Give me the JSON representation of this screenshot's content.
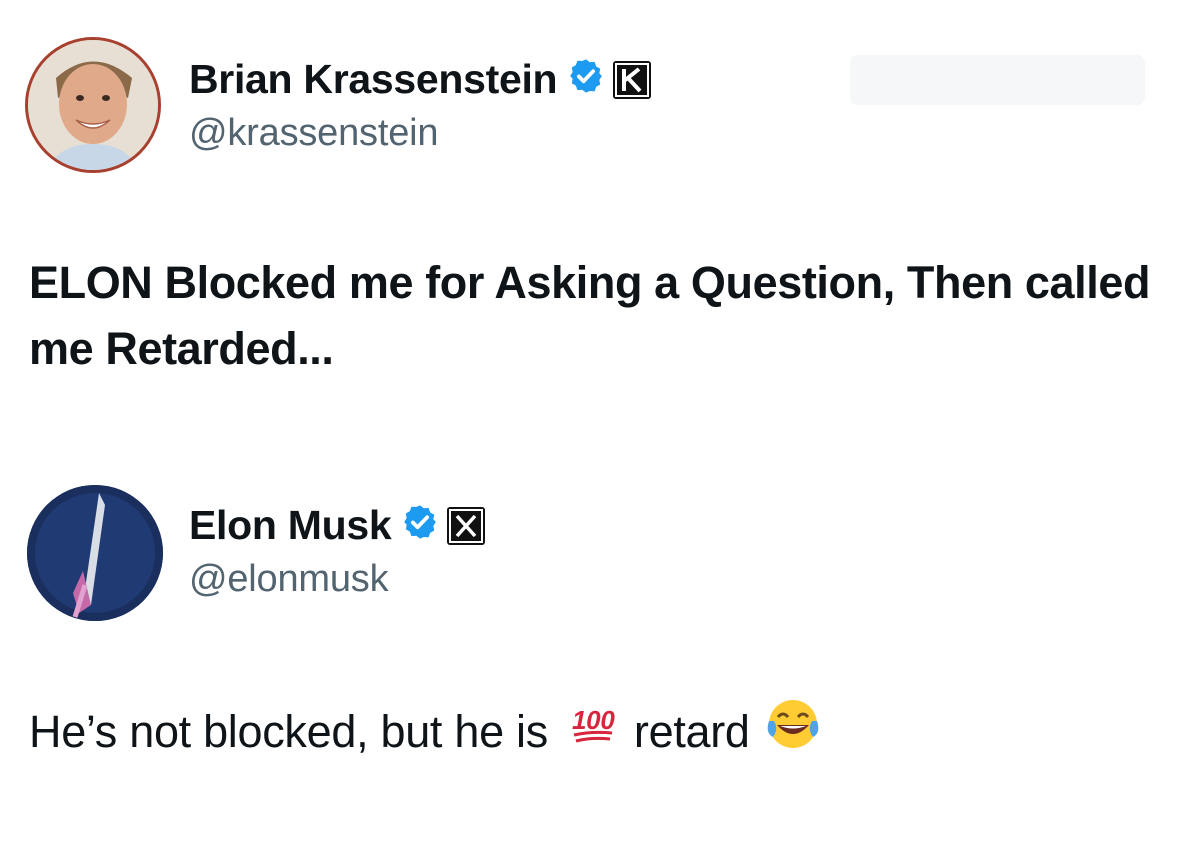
{
  "tweets": [
    {
      "name": "Brian Krassenstein",
      "handle": "@krassenstein",
      "text": "ELON Blocked me for Asking a Question, Then called me Retarded...",
      "badge_color": "#1d9bf0",
      "brand_icon": "k-logo-icon"
    },
    {
      "name": "Elon Musk",
      "handle": "@elonmusk",
      "text_before": "He’s not blocked, but he is",
      "text_after": "retard",
      "badge_color": "#1d9bf0",
      "brand_icon": "x-logo-icon",
      "emojis": [
        "hundred-points-icon",
        "tears-of-joy-icon"
      ]
    }
  ]
}
